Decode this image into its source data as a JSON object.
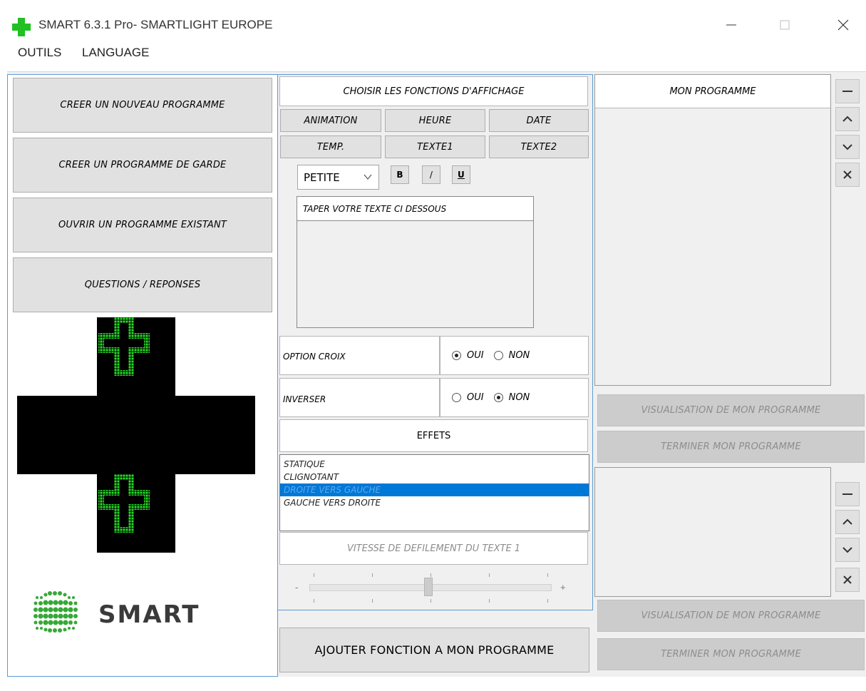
{
  "window": {
    "title": "SMART 6.3.1 Pro- SMARTLIGHT EUROPE",
    "controls": [
      "minimize",
      "maximize",
      "close"
    ],
    "accent_color": "#0078d7",
    "app_icon": "green-cross-icon"
  },
  "menu": {
    "items": [
      {
        "label": "OUTILS"
      },
      {
        "label": "LANGUAGE"
      }
    ]
  },
  "left": {
    "buttons": [
      {
        "label": "CREER UN NOUVEAU PROGRAMME"
      },
      {
        "label": "CREER UN PROGRAMME DE GARDE"
      },
      {
        "label": "OUVRIR UN PROGRAMME EXISTANT"
      },
      {
        "label": "QUESTIONS / REPONSES"
      }
    ],
    "logo_text": "SMART",
    "led_color": "#22dd22"
  },
  "middle": {
    "header": "CHOISIR LES FONCTIONS D'AFFICHAGE",
    "function_buttons": [
      {
        "label": "ANIMATION"
      },
      {
        "label": "HEURE"
      },
      {
        "label": "DATE"
      },
      {
        "label": "TEMP."
      },
      {
        "label": "TEXTE1"
      },
      {
        "label": "TEXTE2"
      }
    ],
    "font_size_select": {
      "value": "PETITE"
    },
    "format_buttons": {
      "bold": "B",
      "italic": "/",
      "underline": "U"
    },
    "text_area": {
      "header": "TAPER VOTRE TEXTE CI DESSOUS",
      "value": ""
    },
    "option_croix": {
      "label": "OPTION CROIX",
      "oui": "OUI",
      "non": "NON",
      "selected": "OUI"
    },
    "inverser": {
      "label": "INVERSER",
      "oui": "OUI",
      "non": "NON",
      "selected": "NON"
    },
    "effects": {
      "header": "EFFETS",
      "items": [
        "STATIQUE",
        "CLIGNOTANT",
        "DROITE VERS GAUCHE",
        "GAUCHE VERS DROITE"
      ],
      "selected_index": 2
    },
    "speed": {
      "label": "VITESSE DE DEFILEMENT DU TEXTE 1",
      "minus": "-",
      "plus": "+",
      "value_fraction": 0.49
    },
    "add_button": "AJOUTER FONCTION A MON PROGRAMME"
  },
  "right": {
    "program_header": "MON PROGRAMME",
    "visualize_button": "VISUALISATION DE MON PROGRAMME",
    "finish_button": "TERMINER MON PROGRAMME",
    "visualize_button_2": "VISUALISATION DE MON PROGRAMME",
    "finish_button_2": "TERMINER MON PROGRAMME",
    "list_tools": [
      "minus-icon",
      "chevron-up-icon",
      "chevron-down-icon",
      "close-icon"
    ]
  }
}
